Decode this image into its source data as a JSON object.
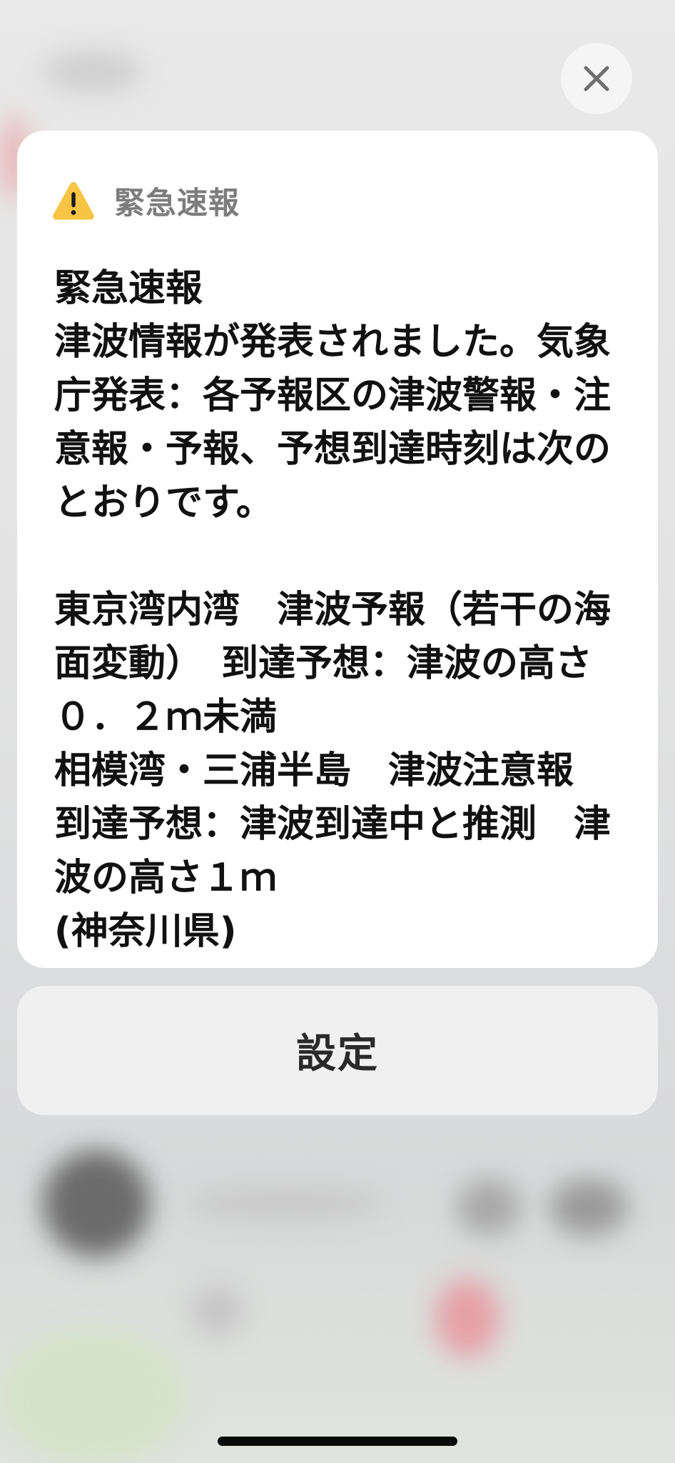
{
  "alert": {
    "header_title": "緊急速報",
    "body_text": "緊急速報\n津波情報が発表されました。気象庁発表：各予報区の津波警報・注意報・予報、予想到達時刻は次のとおりです。\n\n東京湾内湾　津波予報（若干の海面変動）　到達予想：津波の高さ０．２ｍ未満\n相模湾・三浦半島　津波注意報　到達予想：津波到達中と推測　津波の高さ１ｍ\n(神奈川県)"
  },
  "settings_button": {
    "label": "設定"
  },
  "icons": {
    "warning": "warning-triangle-icon",
    "close": "close-icon"
  },
  "colors": {
    "warning_yellow": "#f7c543",
    "header_gray": "#7d7d7d",
    "card_background": "#ffffff"
  }
}
